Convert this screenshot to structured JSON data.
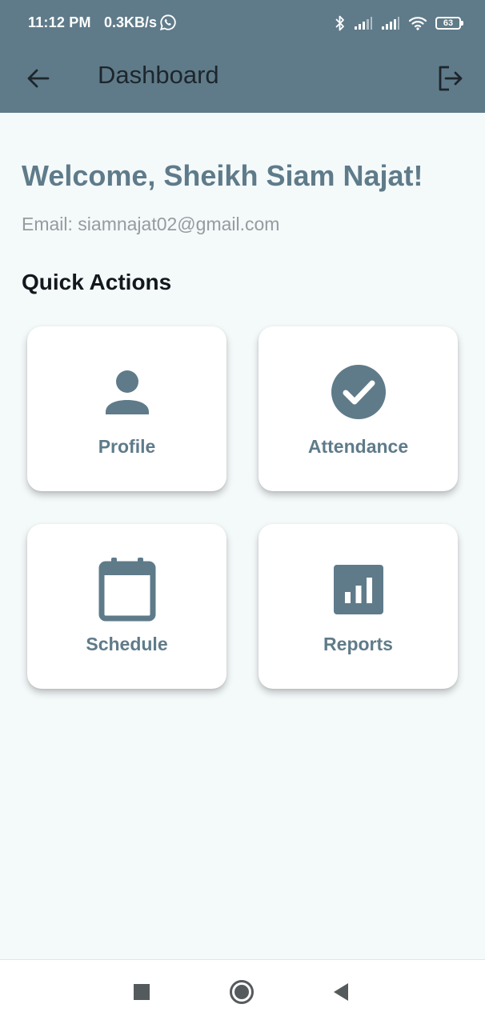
{
  "status_bar": {
    "time": "11:12 PM",
    "net_speed": "0.3KB/s",
    "battery_level": "63",
    "icons": [
      "whatsapp-icon",
      "bluetooth-icon",
      "signal-icon",
      "signal-icon",
      "wifi-icon",
      "battery-icon"
    ]
  },
  "app_bar": {
    "title": "Dashboard",
    "back_icon": "arrow-left-icon",
    "logout_icon": "logout-icon",
    "background": "#5f7b8a"
  },
  "greeting": {
    "welcome": "Welcome, Sheikh Siam Najat!",
    "email": "Email: siamnajat02@gmail.com"
  },
  "quick_actions": {
    "title": "Quick Actions",
    "items": [
      {
        "label": "Profile",
        "icon": "person-icon"
      },
      {
        "label": "Attendance",
        "icon": "check-circle-icon"
      },
      {
        "label": "Schedule",
        "icon": "calendar-icon"
      },
      {
        "label": "Reports",
        "icon": "bar-chart-icon"
      }
    ]
  },
  "nav_bar": {
    "buttons": [
      "recents-icon",
      "home-icon",
      "back-icon"
    ]
  },
  "colors": {
    "accent": "#5f7b8a",
    "background": "#f4f9fa",
    "card": "#ffffff",
    "muted_text": "#959c9f"
  }
}
